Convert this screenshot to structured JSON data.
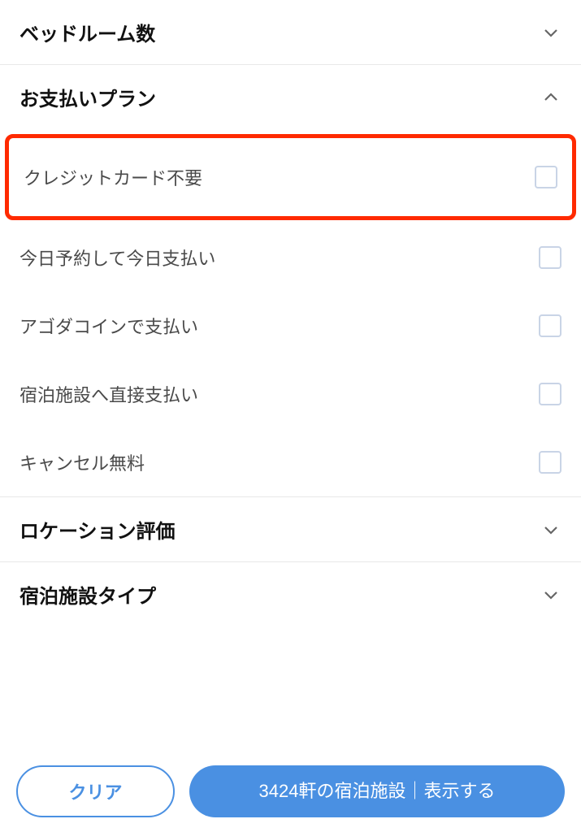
{
  "sections": {
    "bedroom_count": {
      "title": "ベッドルーム数",
      "expanded": false
    },
    "payment_plan": {
      "title": "お支払いプラン",
      "expanded": true,
      "options": [
        {
          "label": "クレジットカード不要",
          "checked": false
        },
        {
          "label": "今日予約して今日支払い",
          "checked": false
        },
        {
          "label": "アゴダコインで支払い",
          "checked": false
        },
        {
          "label": "宿泊施設へ直接支払い",
          "checked": false
        },
        {
          "label": "キャンセル無料",
          "checked": false
        }
      ]
    },
    "location_rating": {
      "title": "ロケーション評価",
      "expanded": false
    },
    "property_type": {
      "title": "宿泊施設タイプ",
      "expanded": false
    }
  },
  "footer": {
    "clear_label": "クリア",
    "show_label": "3424軒の宿泊施設｜表示する"
  }
}
